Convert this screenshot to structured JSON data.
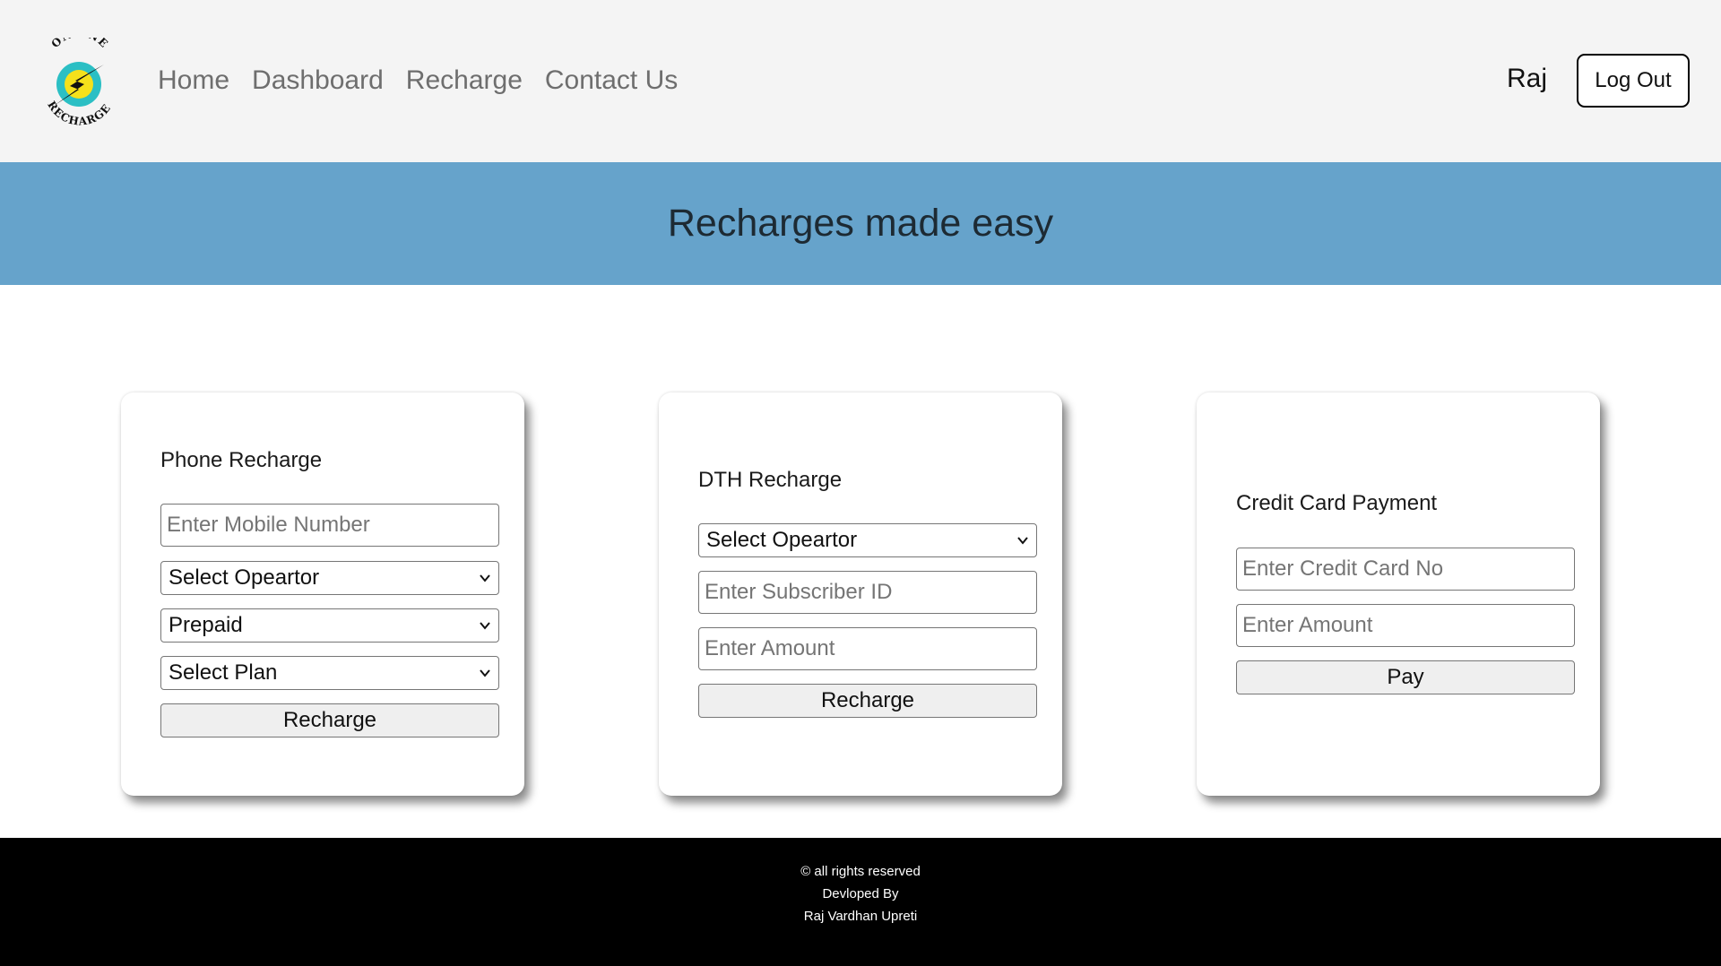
{
  "header": {
    "logo": {
      "top_text": "ONLINE",
      "bottom_text": "RECHARGE",
      "icon": "lightning-bolt-icon"
    },
    "nav": [
      "Home",
      "Dashboard",
      "Recharge",
      "Contact Us"
    ],
    "username": "Raj",
    "logout_label": "Log Out"
  },
  "banner": {
    "title": "Recharges made easy"
  },
  "cards": {
    "phone": {
      "title": "Phone Recharge",
      "mobile_placeholder": "Enter Mobile Number",
      "operator_value": "Select Opeartor",
      "type_value": "Prepaid",
      "plan_value": "Select Plan",
      "button_label": "Recharge"
    },
    "dth": {
      "title": "DTH Recharge",
      "operator_value": "Select Opeartor",
      "subscriber_placeholder": "Enter Subscriber ID",
      "amount_placeholder": "Enter Amount",
      "button_label": "Recharge"
    },
    "credit": {
      "title": "Credit Card Payment",
      "card_placeholder": "Enter Credit Card No",
      "amount_placeholder": "Enter Amount",
      "button_label": "Pay"
    }
  },
  "footer": {
    "line1": "© all rights reserved",
    "line2": "Devloped By",
    "line3": "Raj Vardhan Upreti"
  },
  "colors": {
    "header_bg": "#f4f4f4",
    "banner_bg": "#66a3cb",
    "footer_bg": "#000000",
    "nav_text": "#6e6e6e",
    "logo_yellow": "#f5e11b",
    "logo_teal": "#2bbfc4"
  }
}
